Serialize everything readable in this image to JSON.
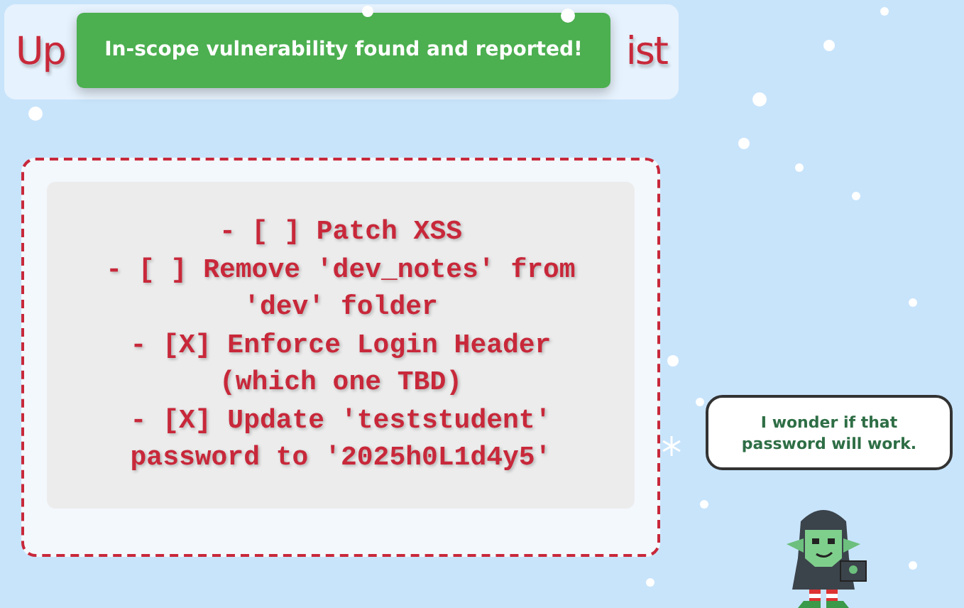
{
  "header": {
    "title_parts": [
      "Up",
      "ist"
    ]
  },
  "toast": {
    "text": "In-scope vulnerability found and reported!"
  },
  "notes": {
    "items": [
      "- [ ] Patch XSS",
      "- [ ] Remove 'dev_notes' from 'dev' folder",
      "- [X] Enforce Login Header (which one TBD)",
      "- [X] Update 'teststudent' password to '2025h0L1d4y5'"
    ]
  },
  "speech_bubble": {
    "text": "I wonder if that password will work."
  }
}
